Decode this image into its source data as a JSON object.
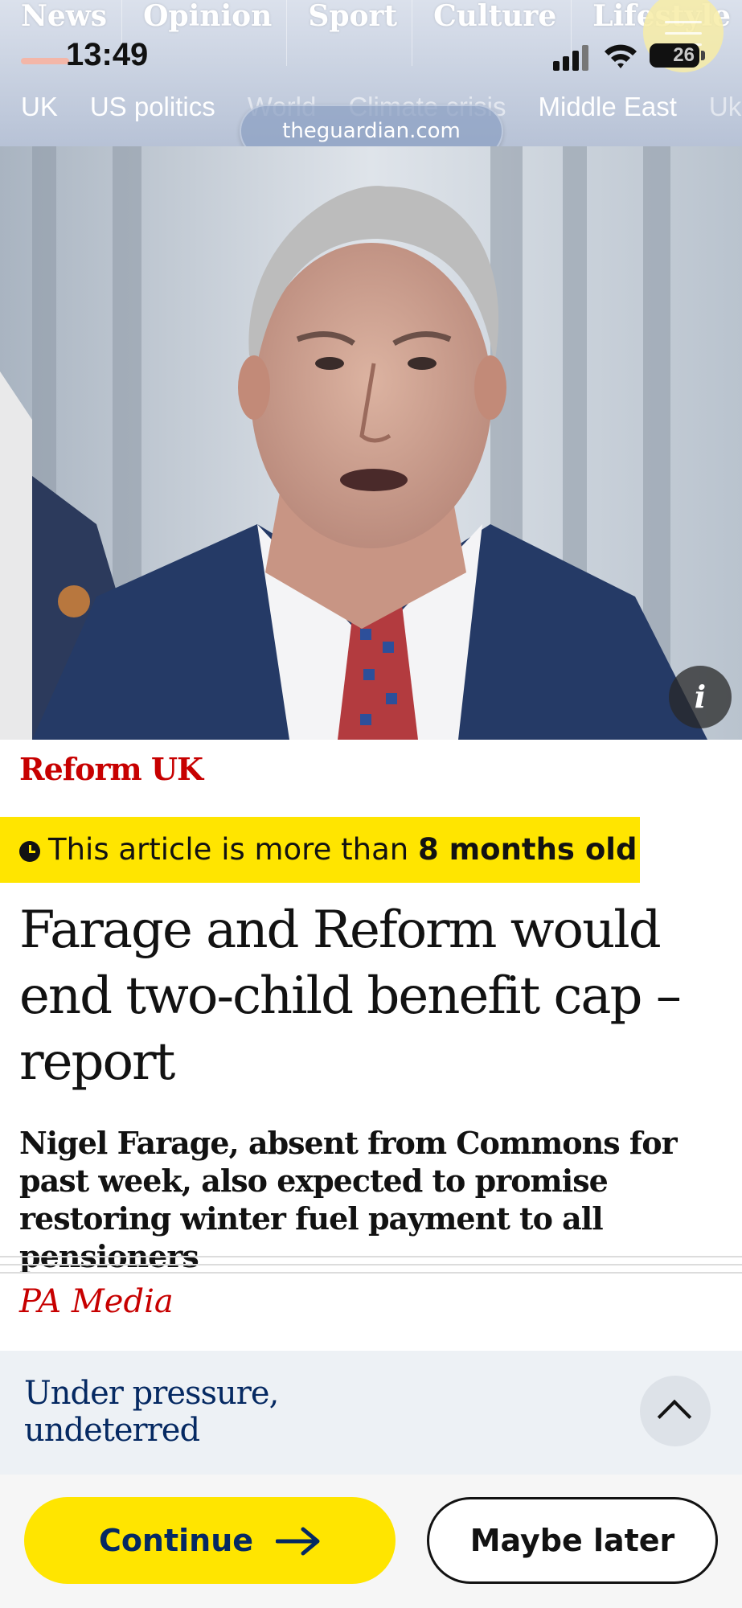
{
  "header": {
    "pillars": [
      "News",
      "Opinion",
      "Sport",
      "Culture",
      "Lifestyle"
    ],
    "subnav": [
      "UK",
      "US politics",
      "World",
      "Climate crisis",
      "Middle East",
      "Ukr"
    ],
    "url": "theguardian.com"
  },
  "status_bar": {
    "time": "13:49",
    "battery": "26"
  },
  "hero": {
    "image_description": "photo",
    "info_label": "i"
  },
  "article": {
    "kicker": "Reform UK",
    "age_notice_prefix": "This article is more than",
    "age_notice_bold": "8 months old",
    "headline": "Farage and Reform would end two-child benefit cap – report",
    "standfirst": "Nigel Farage, absent from Commons for past week, also expected to promise restoring winter fuel payment to all pensioners",
    "byline": "PA Media"
  },
  "support_sheet": {
    "title_line1": "Under pressure,",
    "title_line2": "undeterred",
    "continue_label": "Continue",
    "later_label": "Maybe later"
  },
  "colors": {
    "brand_red": "#c70000",
    "banner_yellow": "#ffe500",
    "guardian_blue": "#052962"
  }
}
